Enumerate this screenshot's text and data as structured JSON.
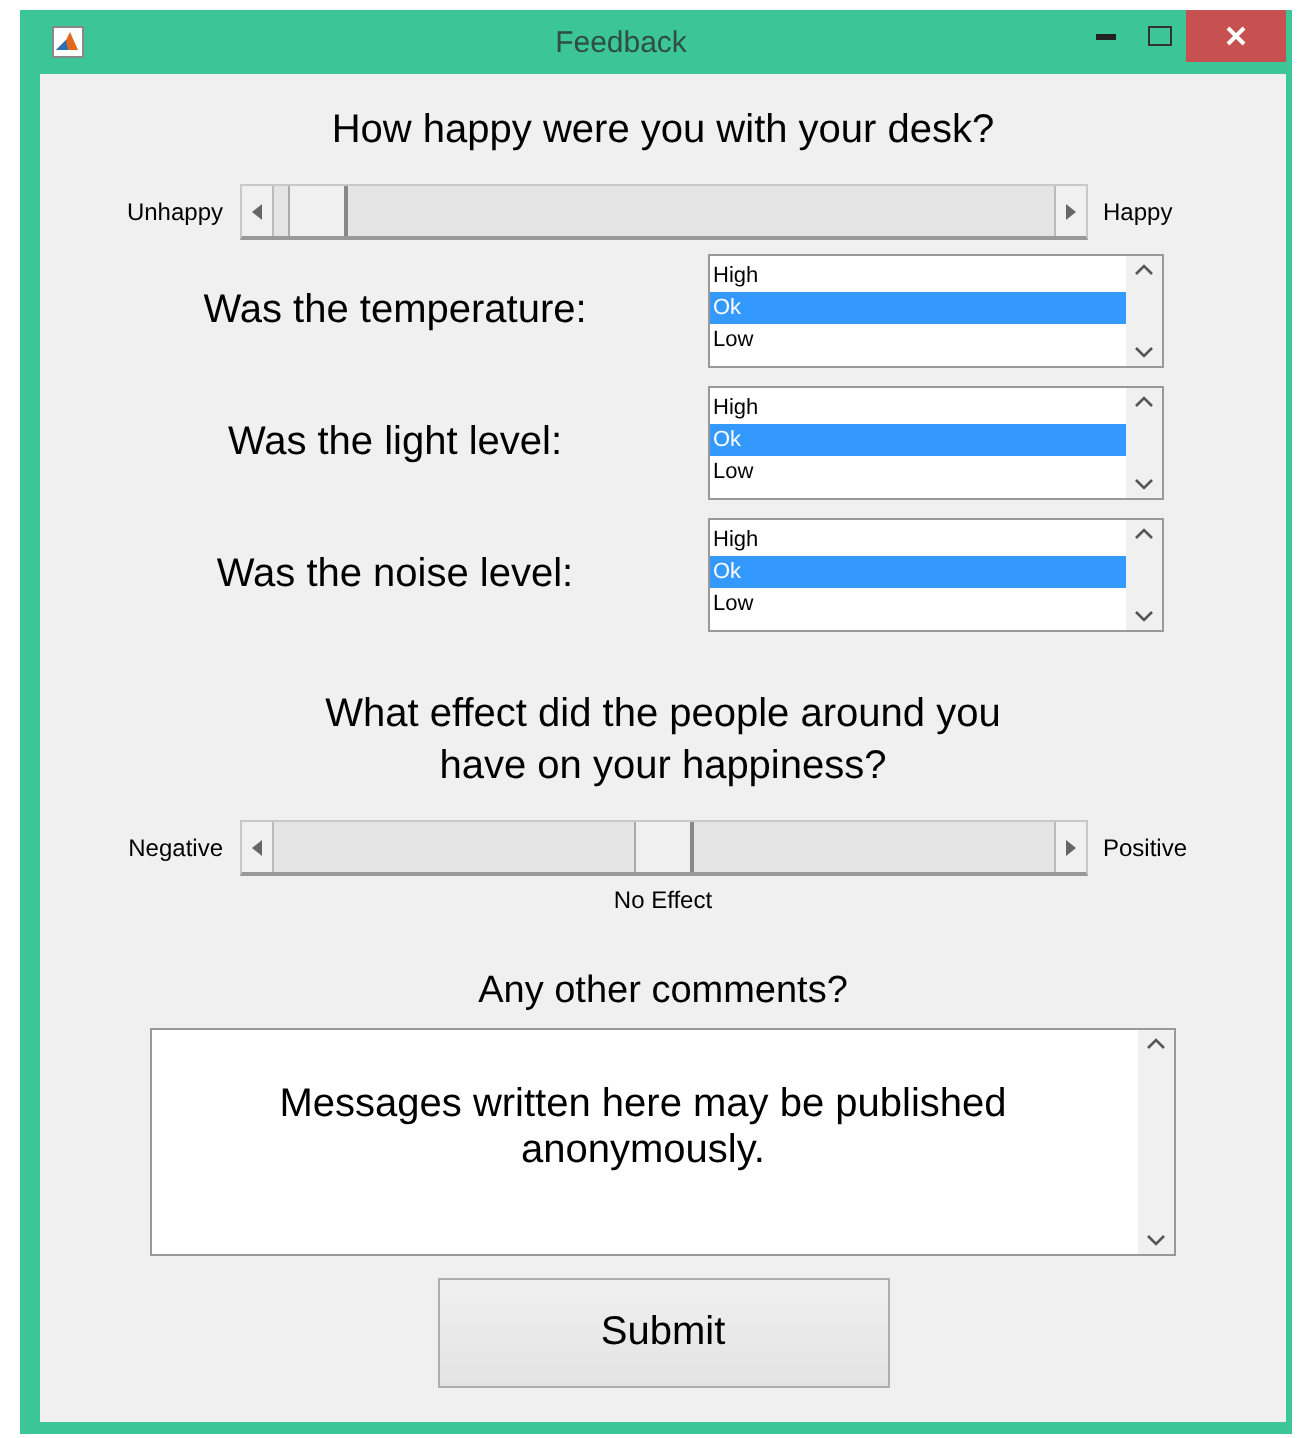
{
  "window": {
    "title": "Feedback"
  },
  "desk_question": {
    "text": "How happy were you with your desk?",
    "slider": {
      "min_label": "Unhappy",
      "max_label": "Happy",
      "level": 0.02
    }
  },
  "ratings": [
    {
      "label": "Was the temperature:",
      "options": [
        {
          "text": "High",
          "selected": false
        },
        {
          "text": "Ok",
          "selected": true
        },
        {
          "text": "Low",
          "selected": false
        }
      ]
    },
    {
      "label": "Was the light level:",
      "options": [
        {
          "text": "High",
          "selected": false
        },
        {
          "text": "Ok",
          "selected": true
        },
        {
          "text": "Low",
          "selected": false
        }
      ]
    },
    {
      "label": "Was the noise level:",
      "options": [
        {
          "text": "High",
          "selected": false
        },
        {
          "text": "Ok",
          "selected": true
        },
        {
          "text": "Low",
          "selected": false
        }
      ]
    }
  ],
  "people_question": {
    "text": "What effect did the people around you have on your happiness?",
    "slider": {
      "min_label": "Negative",
      "max_label": "Positive",
      "level": 0.5,
      "mid_label": "No Effect"
    }
  },
  "comments": {
    "label": "Any other comments?",
    "value": "Messages written here may be published anonymously."
  },
  "submit": "Submit"
}
